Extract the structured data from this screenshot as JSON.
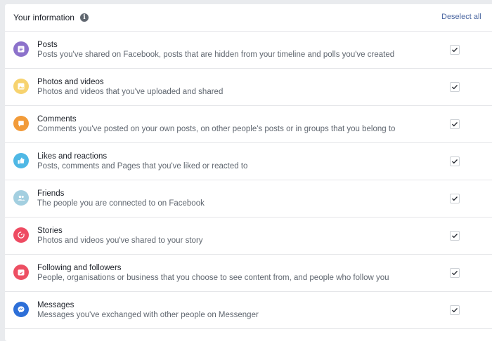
{
  "header": {
    "title": "Your information",
    "info_icon": "i",
    "deselect_label": "Deselect all"
  },
  "items": [
    {
      "name": "Posts",
      "description": "Posts you've shared on Facebook, posts that are hidden from your timeline and polls you've created",
      "icon": "posts-icon",
      "color": "#8c72cb",
      "checked": true
    },
    {
      "name": "Photos and videos",
      "description": "Photos and videos that you've uploaded and shared",
      "icon": "photo-icon",
      "color": "#f7d36f",
      "checked": true
    },
    {
      "name": "Comments",
      "description": "Comments you've posted on your own posts, on other people's posts or in groups that you belong to",
      "icon": "comment-icon",
      "color": "#f29b39",
      "checked": true
    },
    {
      "name": "Likes and reactions",
      "description": "Posts, comments and Pages that you've liked or reacted to",
      "icon": "thumbs-up-icon",
      "color": "#4fb8e5",
      "checked": true
    },
    {
      "name": "Friends",
      "description": "The people you are connected to on Facebook",
      "icon": "friends-icon",
      "color": "#a3cfe0",
      "checked": true
    },
    {
      "name": "Stories",
      "description": "Photos and videos you've shared to your story",
      "icon": "stories-icon",
      "color": "#ee4b62",
      "checked": true
    },
    {
      "name": "Following and followers",
      "description": "People, organisations or business that you choose to see content from, and people who follow you",
      "icon": "following-icon",
      "color": "#ed4f63",
      "checked": true
    },
    {
      "name": "Messages",
      "description": "Messages you've exchanged with other people on Messenger",
      "icon": "messenger-icon",
      "color": "#2d6fd8",
      "checked": true
    }
  ]
}
